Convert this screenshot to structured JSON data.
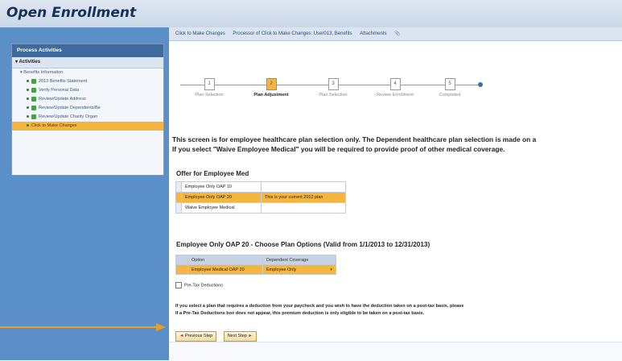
{
  "window": {
    "title": "Open Enrollment"
  },
  "sidebar": {
    "header": "Process Activities",
    "subheader": "Activities",
    "items": [
      {
        "label": "Benefits Information",
        "indent": 1,
        "type": "parent"
      },
      {
        "label": "2013 Benefits Statement",
        "indent": 2,
        "type": "done"
      },
      {
        "label": "Verify Personal Data",
        "indent": 2,
        "type": "done"
      },
      {
        "label": "Review/Update Address",
        "indent": 2,
        "type": "done"
      },
      {
        "label": "Review/Update Dependents/Be",
        "indent": 2,
        "type": "done"
      },
      {
        "label": "Review/Update Charity Organ",
        "indent": 2,
        "type": "done"
      },
      {
        "label": "Click to Make Changes",
        "indent": 2,
        "type": "selected"
      }
    ]
  },
  "topbar": {
    "link1": "Click to Make Changes",
    "processor": "Processor of Click to Make Changes: User013, Benefits",
    "attachments": "Attachments"
  },
  "steps": [
    {
      "num": "1",
      "label": "Plan Selection",
      "active": false
    },
    {
      "num": "2",
      "label": "Plan Adjustment",
      "active": true
    },
    {
      "num": "3",
      "label": "Plan Selection",
      "active": false
    },
    {
      "num": "4",
      "label": "Review Enrollment",
      "active": false
    },
    {
      "num": "5",
      "label": "Completed",
      "active": false
    }
  ],
  "intro": {
    "line1": "This screen is for employee healthcare plan selection only. The Dependent healthcare plan selection is made on a",
    "line2": "If you select \"Waive Employee Medical\" you will be required to provide proof of other medical coverage."
  },
  "offer": {
    "title": "Offer for Employee Med",
    "rows": [
      {
        "plan": "Employee Only OAP 10",
        "note": "",
        "selected": false
      },
      {
        "plan": "Employee Only OAP 20",
        "note": "This is your current 2012 plan",
        "selected": true
      },
      {
        "plan": "Waive Employee Medical",
        "note": "",
        "selected": false
      }
    ]
  },
  "options": {
    "title": "Employee Only OAP 20 - Choose Plan Options (Valid from 1/1/2013 to 12/31/2013)",
    "headers": [
      "Option",
      "Dependent Coverage"
    ],
    "rows": [
      {
        "option": "Employee Medical OAP 20",
        "coverage": "Employee Only",
        "selected": true
      }
    ]
  },
  "checkbox": {
    "label": "Pre-Tax Deductions"
  },
  "note": {
    "line1": "If you select a plan that requires a deduction from your paycheck and you wish to have the deduction taken on a post-tax basis, please",
    "line2": "If a Pre-Tax Deductions box does not appear, this premium deduction is only eligible to be taken on a post-tax basis."
  },
  "buttons": {
    "previous": "Previous Step",
    "next": "Next Step"
  },
  "colors": {
    "accent": "#f5b640",
    "sidebar": "#5a8fc8",
    "arrow": "#e8a020"
  }
}
